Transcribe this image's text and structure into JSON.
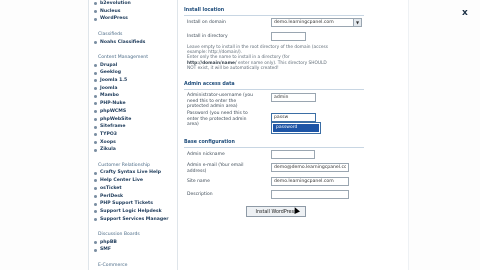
{
  "sidebar": {
    "items": [
      {
        "type": "item",
        "label": "b2evolution"
      },
      {
        "type": "item",
        "label": "Nucleus"
      },
      {
        "type": "item",
        "label": "WordPress"
      },
      {
        "type": "gap"
      },
      {
        "type": "heading",
        "label": "Classifieds"
      },
      {
        "type": "item",
        "label": "Noahs Classifieds"
      },
      {
        "type": "gap"
      },
      {
        "type": "heading",
        "label": "Content Management"
      },
      {
        "type": "item",
        "label": "Drupal"
      },
      {
        "type": "item",
        "label": "Geeklog"
      },
      {
        "type": "item",
        "label": "Joomla 1.5"
      },
      {
        "type": "item",
        "label": "Joomla"
      },
      {
        "type": "item",
        "label": "Mambo"
      },
      {
        "type": "item",
        "label": "PHP-Nuke"
      },
      {
        "type": "item",
        "label": "phpWCMS"
      },
      {
        "type": "item",
        "label": "phpWebSite"
      },
      {
        "type": "item",
        "label": "Siteframe"
      },
      {
        "type": "item",
        "label": "TYPO3"
      },
      {
        "type": "item",
        "label": "Xoops"
      },
      {
        "type": "item",
        "label": "Zikula"
      },
      {
        "type": "gap"
      },
      {
        "type": "heading",
        "label": "Customer Relationship"
      },
      {
        "type": "item",
        "label": "Crafty Syntax Live Help"
      },
      {
        "type": "item",
        "label": "Help Center Live"
      },
      {
        "type": "item",
        "label": "osTicket"
      },
      {
        "type": "item",
        "label": "PerlDesk"
      },
      {
        "type": "item",
        "label": "PHP Support Tickets"
      },
      {
        "type": "item",
        "label": "Support Logic Helpdesk"
      },
      {
        "type": "item",
        "label": "Support Services Manager"
      },
      {
        "type": "gap"
      },
      {
        "type": "heading",
        "label": "Discussion Boards"
      },
      {
        "type": "item",
        "label": "phpBB"
      },
      {
        "type": "item",
        "label": "SMF"
      },
      {
        "type": "gap"
      },
      {
        "type": "heading",
        "label": "E-Commerce"
      }
    ]
  },
  "install_location": {
    "heading": "Install location",
    "domain_label": "Install on domain",
    "domain_value": "demo.learningcpanel.com",
    "dir_label": "Install in directory",
    "dir_value": "",
    "help_line1": "Leave empty to install in the root directory of the domain (access",
    "help_line2": "example: http://domain/).",
    "help_line3": "Enter only the name to install in a directory (for",
    "help_line4_bold": "http://domain/name/",
    "help_line4_rest": " enter name only). This directory SHOULD",
    "help_line5": "NOT exist, it will be automatically created!"
  },
  "admin_access": {
    "heading": "Admin access data",
    "username_label1": "Administrator-username (you",
    "username_label2": "need this to enter the",
    "username_label3": "protected admin area)",
    "username_value": "admin",
    "password_label1": "Password (you need this to",
    "password_label2": "enter the protected admin",
    "password_label3": "area)",
    "password_value": "passw",
    "autocomplete_option": "password"
  },
  "base_config": {
    "heading": "Base configuration",
    "nickname_label": "Admin nickname",
    "nickname_value": "",
    "email_label1": "Admin e-mail (Your email",
    "email_label2": "address)",
    "email_value": "demo@demo.learningcpanel.com",
    "sitename_label": "Site name",
    "sitename_value": "demo.learningcpanel.com",
    "description_label": "Description",
    "description_value": ""
  },
  "install_button": "Install WordPress",
  "close_label": "x"
}
